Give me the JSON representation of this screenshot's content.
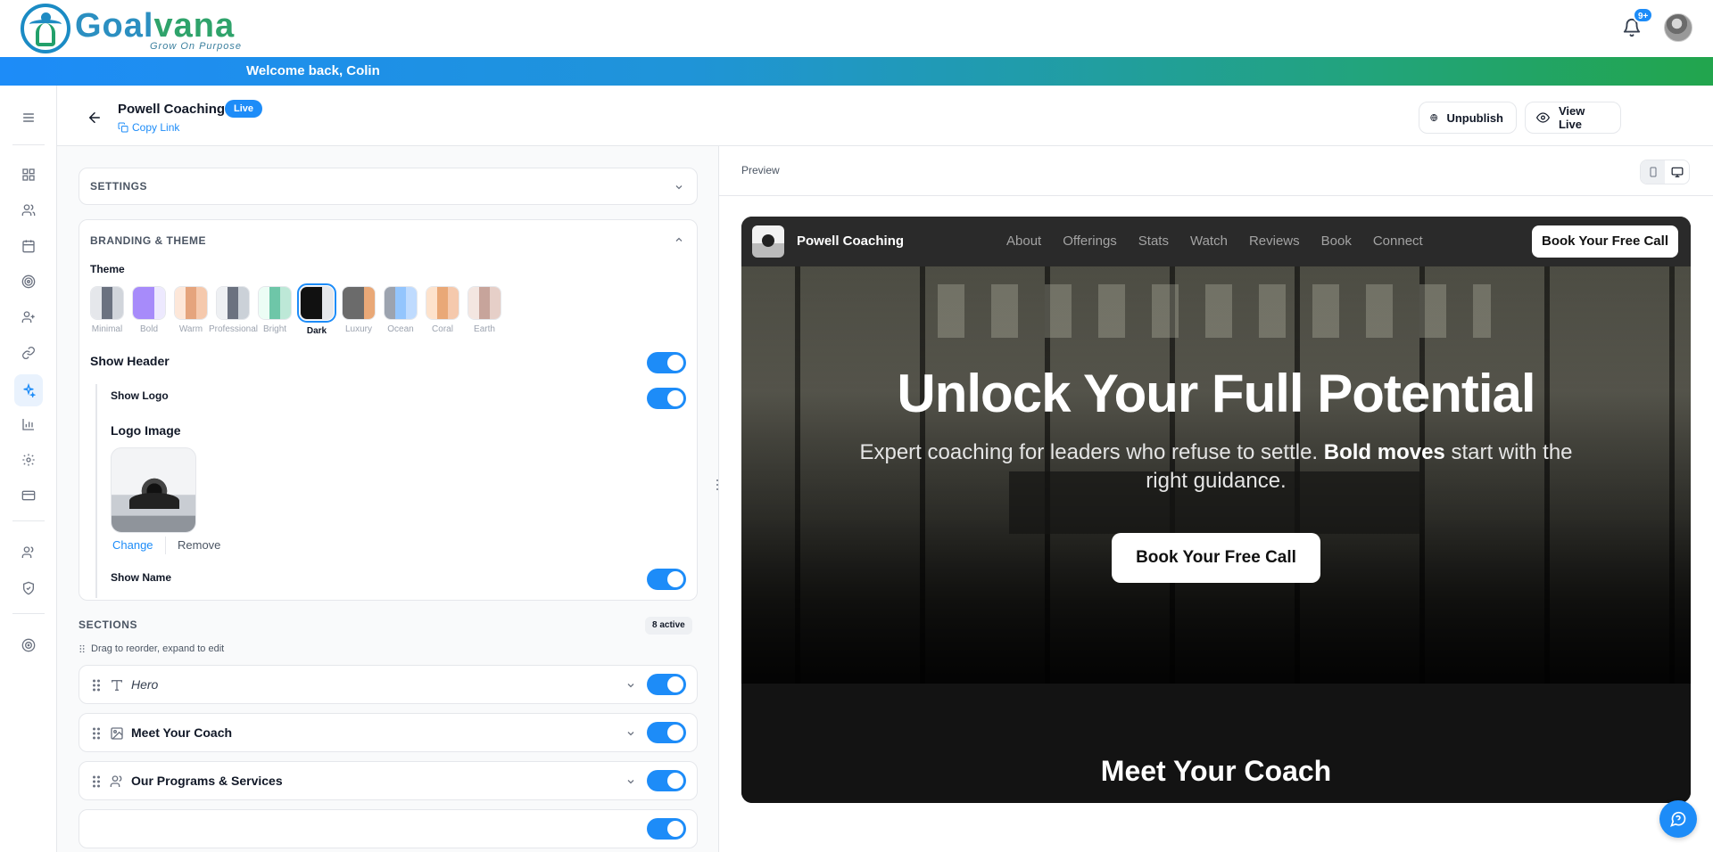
{
  "app": {
    "brand": "Goalvana",
    "brand_part1": "Goal",
    "brand_part2": "vana",
    "tagline": "Grow On Purpose",
    "notifications_badge": "9+",
    "welcome": "Welcome back, Colin"
  },
  "sidebar": {
    "items": [
      {
        "icon": "dashboard-icon",
        "active": false
      },
      {
        "icon": "users-icon",
        "active": false
      },
      {
        "icon": "calendar-icon",
        "active": false
      },
      {
        "icon": "target-icon",
        "active": false
      },
      {
        "icon": "user-plus-icon",
        "active": false
      },
      {
        "icon": "link-icon",
        "active": false
      },
      {
        "icon": "sparkle-icon",
        "active": true
      },
      {
        "icon": "bar-chart-icon",
        "active": false
      },
      {
        "icon": "settings-icon",
        "active": false
      },
      {
        "icon": "credit-card-icon",
        "active": false
      },
      {
        "icon": "team-icon",
        "active": false
      },
      {
        "icon": "shield-icon",
        "active": false
      },
      {
        "icon": "goal-icon",
        "active": false
      }
    ]
  },
  "page": {
    "title": "Powell Coaching",
    "status": "Live",
    "copy_link": "Copy Link",
    "unpublish": "Unpublish",
    "view_live": "View Live"
  },
  "settings": {
    "title": "SETTINGS"
  },
  "branding": {
    "title": "BRANDING & THEME",
    "theme_label": "Theme",
    "themes": [
      {
        "name": "Minimal",
        "colors": [
          "#e5e7eb",
          "#6b7280",
          "#d1d5db"
        ]
      },
      {
        "name": "Bold",
        "colors": [
          "#a78bfa",
          "#a78bfa",
          "#ede9fe"
        ]
      },
      {
        "name": "Warm",
        "colors": [
          "#fde7d9",
          "#e5a47d",
          "#f5c9ad"
        ]
      },
      {
        "name": "Professional",
        "colors": [
          "#eef0f3",
          "#6b7280",
          "#cbd1d8"
        ]
      },
      {
        "name": "Bright",
        "colors": [
          "#ecfdf5",
          "#6ec6a8",
          "#bde8d7"
        ]
      },
      {
        "name": "Dark",
        "colors": [
          "#111111",
          "#111111",
          "#e5e7eb"
        ]
      },
      {
        "name": "Luxury",
        "colors": [
          "#6b6b6b",
          "#6b6b6b",
          "#e9a877"
        ]
      },
      {
        "name": "Ocean",
        "colors": [
          "#9ca3af",
          "#93c5fd",
          "#bfdbfe"
        ]
      },
      {
        "name": "Coral",
        "colors": [
          "#fde2cc",
          "#e9a877",
          "#f5c9ad"
        ]
      },
      {
        "name": "Earth",
        "colors": [
          "#f3e6e1",
          "#c7a49b",
          "#e6cfc8"
        ]
      }
    ],
    "selected_theme": "Dark",
    "show_header": "Show Header",
    "show_logo": "Show Logo",
    "logo_image": "Logo Image",
    "change": "Change",
    "remove": "Remove",
    "show_name": "Show Name"
  },
  "sections": {
    "title": "SECTIONS",
    "count": "8 active",
    "hint": "Drag to reorder, expand to edit",
    "items": [
      {
        "title": "Hero",
        "icon": "text-icon",
        "enabled": true
      },
      {
        "title": "Meet Your Coach",
        "icon": "image-icon",
        "enabled": true
      },
      {
        "title": "Our Programs & Services",
        "icon": "users-icon",
        "enabled": true
      }
    ]
  },
  "preview": {
    "label": "Preview",
    "site": {
      "name": "Powell Coaching",
      "nav": [
        "About",
        "Offerings",
        "Stats",
        "Watch",
        "Reviews",
        "Book",
        "Connect"
      ],
      "cta": "Book Your Free Call",
      "hero_title": "Unlock Your Full Potential",
      "hero_sub_part1": "Expert coaching for leaders who refuse to settle.",
      "hero_sub_bold": "Bold moves",
      "hero_sub_part2": "start with the right guidance.",
      "hero_button": "Book Your Free Call",
      "section2_title": "Meet Your Coach"
    }
  },
  "colors": {
    "accent": "#1d8cf8",
    "brand_blue": "#2b8fc1",
    "brand_green": "#2fa36b"
  }
}
